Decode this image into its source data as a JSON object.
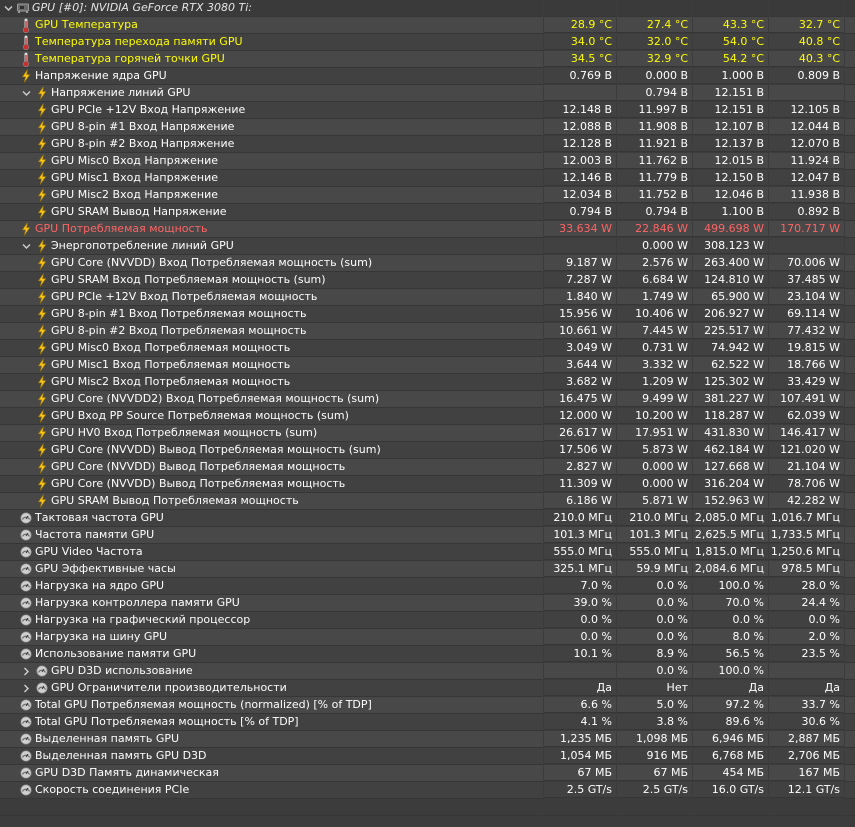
{
  "colors": {
    "highlight_yellow": "#ffff00",
    "highlight_red": "#ff6464",
    "row_odd": "#484848",
    "row_even": "#414141"
  },
  "group_header": {
    "label": "GPU [#0]: NVIDIA GeForce RTX 3080 Ti:",
    "icon": "gpu-icon",
    "expander": "chevron-down-icon"
  },
  "rows": [
    {
      "label": "GPU Температура",
      "icon": "thermometer-icon",
      "level": 0,
      "hl": "y",
      "v": [
        "28.9 °C",
        "27.4 °C",
        "43.3 °C",
        "32.7 °C"
      ]
    },
    {
      "label": "Температура перехода памяти GPU",
      "icon": "thermometer-icon",
      "level": 0,
      "hl": "y",
      "v": [
        "34.0 °C",
        "32.0 °C",
        "54.0 °C",
        "40.8 °C"
      ]
    },
    {
      "label": "Температура горячей точки GPU",
      "icon": "thermometer-icon",
      "level": 0,
      "hl": "y",
      "v": [
        "34.5 °C",
        "32.9 °C",
        "54.2 °C",
        "40.3 °C"
      ]
    },
    {
      "label": "Напряжение ядра GPU",
      "icon": "lightning-icon",
      "level": 0,
      "v": [
        "0.769 В",
        "0.000 В",
        "1.000 В",
        "0.809 В"
      ]
    },
    {
      "label": "Напряжение линий GPU",
      "icon": "lightning-icon",
      "level": 1,
      "expander": "chevron-down-icon",
      "v": [
        "",
        "0.794 В",
        "12.151 В",
        ""
      ]
    },
    {
      "label": "GPU PCIe +12V Вход Напряжение",
      "icon": "lightning-icon",
      "level": 1,
      "v": [
        "12.148 В",
        "11.997 В",
        "12.151 В",
        "12.105 В"
      ]
    },
    {
      "label": "GPU 8-pin #1 Вход Напряжение",
      "icon": "lightning-icon",
      "level": 1,
      "v": [
        "12.088 В",
        "11.908 В",
        "12.107 В",
        "12.044 В"
      ]
    },
    {
      "label": "GPU 8-pin #2 Вход Напряжение",
      "icon": "lightning-icon",
      "level": 1,
      "v": [
        "12.128 В",
        "11.921 В",
        "12.137 В",
        "12.070 В"
      ]
    },
    {
      "label": "GPU Misc0 Вход Напряжение",
      "icon": "lightning-icon",
      "level": 1,
      "v": [
        "12.003 В",
        "11.762 В",
        "12.015 В",
        "11.924 В"
      ]
    },
    {
      "label": "GPU Misc1 Вход Напряжение",
      "icon": "lightning-icon",
      "level": 1,
      "v": [
        "12.146 В",
        "11.779 В",
        "12.150 В",
        "12.047 В"
      ]
    },
    {
      "label": "GPU Misc2 Вход Напряжение",
      "icon": "lightning-icon",
      "level": 1,
      "v": [
        "12.034 В",
        "11.752 В",
        "12.046 В",
        "11.938 В"
      ]
    },
    {
      "label": "GPU SRAM Вывод Напряжение",
      "icon": "lightning-icon",
      "level": 1,
      "v": [
        "0.794 В",
        "0.794 В",
        "1.100 В",
        "0.892 В"
      ]
    },
    {
      "label": "GPU Потребляемая мощность",
      "icon": "lightning-icon",
      "level": 0,
      "hl": "r",
      "v": [
        "33.634 W",
        "22.846 W",
        "499.698 W",
        "170.717 W"
      ]
    },
    {
      "label": "Энергопотребление линий GPU",
      "icon": "lightning-icon",
      "level": 1,
      "expander": "chevron-down-icon",
      "v": [
        "",
        "0.000 W",
        "308.123 W",
        ""
      ]
    },
    {
      "label": "GPU Core (NVVDD) Вход Потребляемая мощность (sum)",
      "icon": "lightning-icon",
      "level": 1,
      "v": [
        "9.187 W",
        "2.576 W",
        "263.400 W",
        "70.006 W"
      ]
    },
    {
      "label": "GPU SRAM Вход Потребляемая мощность (sum)",
      "icon": "lightning-icon",
      "level": 1,
      "v": [
        "7.287 W",
        "6.684 W",
        "124.810 W",
        "37.485 W"
      ]
    },
    {
      "label": "GPU PCIe +12V Вход Потребляемая мощность",
      "icon": "lightning-icon",
      "level": 1,
      "v": [
        "1.840 W",
        "1.749 W",
        "65.900 W",
        "23.104 W"
      ]
    },
    {
      "label": "GPU 8-pin #1 Вход Потребляемая мощность",
      "icon": "lightning-icon",
      "level": 1,
      "v": [
        "15.956 W",
        "10.406 W",
        "206.927 W",
        "69.114 W"
      ]
    },
    {
      "label": "GPU 8-pin #2 Вход Потребляемая мощность",
      "icon": "lightning-icon",
      "level": 1,
      "v": [
        "10.661 W",
        "7.445 W",
        "225.517 W",
        "77.432 W"
      ]
    },
    {
      "label": "GPU Misc0 Вход Потребляемая мощность",
      "icon": "lightning-icon",
      "level": 1,
      "v": [
        "3.049 W",
        "0.731 W",
        "74.942 W",
        "19.815 W"
      ]
    },
    {
      "label": "GPU Misc1 Вход Потребляемая мощность",
      "icon": "lightning-icon",
      "level": 1,
      "v": [
        "3.644 W",
        "3.332 W",
        "62.522 W",
        "18.766 W"
      ]
    },
    {
      "label": "GPU Misc2 Вход Потребляемая мощность",
      "icon": "lightning-icon",
      "level": 1,
      "v": [
        "3.682 W",
        "1.209 W",
        "125.302 W",
        "33.429 W"
      ]
    },
    {
      "label": "GPU Core (NVVDD2) Вход Потребляемая мощность (sum)",
      "icon": "lightning-icon",
      "level": 1,
      "v": [
        "16.475 W",
        "9.499 W",
        "381.227 W",
        "107.491 W"
      ]
    },
    {
      "label": "GPU Вход PP Source Потребляемая мощность (sum)",
      "icon": "lightning-icon",
      "level": 1,
      "v": [
        "12.000 W",
        "10.200 W",
        "118.287 W",
        "62.039 W"
      ]
    },
    {
      "label": "GPU HV0 Вход Потребляемая мощность (sum)",
      "icon": "lightning-icon",
      "level": 1,
      "v": [
        "26.617 W",
        "17.951 W",
        "431.830 W",
        "146.417 W"
      ]
    },
    {
      "label": "GPU Core (NVVDD) Вывод Потребляемая мощность (sum)",
      "icon": "lightning-icon",
      "level": 1,
      "v": [
        "17.506 W",
        "5.873 W",
        "462.184 W",
        "121.020 W"
      ]
    },
    {
      "label": "GPU Core (NVVDD) Вывод Потребляемая мощность",
      "icon": "lightning-icon",
      "level": 1,
      "v": [
        "2.827 W",
        "0.000 W",
        "127.668 W",
        "21.104 W"
      ]
    },
    {
      "label": "GPU Core (NVVDD) Вывод Потребляемая мощность",
      "icon": "lightning-icon",
      "level": 1,
      "v": [
        "11.309 W",
        "0.000 W",
        "316.204 W",
        "78.706 W"
      ]
    },
    {
      "label": "GPU SRAM Вывод Потребляемая мощность",
      "icon": "lightning-icon",
      "level": 1,
      "v": [
        "6.186 W",
        "5.871 W",
        "152.963 W",
        "42.282 W"
      ]
    },
    {
      "label": "Тактовая частота GPU",
      "icon": "gauge-icon",
      "level": 0,
      "v": [
        "210.0 МГц",
        "210.0 МГц",
        "2,085.0 МГц",
        "1,016.7 МГц"
      ]
    },
    {
      "label": "Частота памяти GPU",
      "icon": "gauge-icon",
      "level": 0,
      "v": [
        "101.3 МГц",
        "101.3 МГц",
        "2,625.5 МГц",
        "1,733.5 МГц"
      ]
    },
    {
      "label": "GPU Video Частота",
      "icon": "gauge-icon",
      "level": 0,
      "v": [
        "555.0 МГц",
        "555.0 МГц",
        "1,815.0 МГц",
        "1,250.6 МГц"
      ]
    },
    {
      "label": "GPU Эффективные часы",
      "icon": "gauge-icon",
      "level": 0,
      "v": [
        "325.1 МГц",
        "59.9 МГц",
        "2,084.6 МГц",
        "978.5 МГц"
      ]
    },
    {
      "label": "Нагрузка на ядро GPU",
      "icon": "gauge-icon",
      "level": 0,
      "v": [
        "7.0 %",
        "0.0 %",
        "100.0 %",
        "28.0 %"
      ]
    },
    {
      "label": "Нагрузка контроллера памяти GPU",
      "icon": "gauge-icon",
      "level": 0,
      "v": [
        "39.0 %",
        "0.0 %",
        "70.0 %",
        "24.4 %"
      ]
    },
    {
      "label": "Нагрузка на графический процессор",
      "icon": "gauge-icon",
      "level": 0,
      "v": [
        "0.0 %",
        "0.0 %",
        "0.0 %",
        "0.0 %"
      ]
    },
    {
      "label": "Нагрузка на шину GPU",
      "icon": "gauge-icon",
      "level": 0,
      "v": [
        "0.0 %",
        "0.0 %",
        "8.0 %",
        "2.0 %"
      ]
    },
    {
      "label": "Использование памяти GPU",
      "icon": "gauge-icon",
      "level": 0,
      "v": [
        "10.1 %",
        "8.9 %",
        "56.5 %",
        "23.5 %"
      ]
    },
    {
      "label": "GPU D3D использование",
      "icon": "gauge-icon",
      "level": 1,
      "expander": "chevron-right-icon",
      "v": [
        "",
        "0.0 %",
        "100.0 %",
        ""
      ]
    },
    {
      "label": "GPU Ограничители производительности",
      "icon": "gauge-icon",
      "level": 1,
      "expander": "chevron-right-icon",
      "v": [
        "Да",
        "Нет",
        "Да",
        "Да"
      ]
    },
    {
      "label": "Total GPU Потребляемая мощность (normalized) [% of TDP]",
      "icon": "gauge-icon",
      "level": 0,
      "v": [
        "6.6 %",
        "5.0 %",
        "97.2 %",
        "33.7 %"
      ]
    },
    {
      "label": "Total GPU Потребляемая мощность [% of TDP]",
      "icon": "gauge-icon",
      "level": 0,
      "v": [
        "4.1 %",
        "3.8 %",
        "89.6 %",
        "30.6 %"
      ]
    },
    {
      "label": "Выделенная память GPU",
      "icon": "gauge-icon",
      "level": 0,
      "v": [
        "1,235 МБ",
        "1,098 МБ",
        "6,946 МБ",
        "2,887 МБ"
      ]
    },
    {
      "label": "Выделенная память GPU D3D",
      "icon": "gauge-icon",
      "level": 0,
      "v": [
        "1,054 МБ",
        "916 МБ",
        "6,768 МБ",
        "2,706 МБ"
      ]
    },
    {
      "label": "GPU D3D Память динамическая",
      "icon": "gauge-icon",
      "level": 0,
      "v": [
        "67 МБ",
        "67 МБ",
        "454 МБ",
        "167 МБ"
      ]
    },
    {
      "label": "Скорость соединения PCIe",
      "icon": "gauge-icon",
      "level": 0,
      "v": [
        "2.5 GT/s",
        "2.5 GT/s",
        "16.0 GT/s",
        "12.1 GT/s"
      ]
    }
  ]
}
